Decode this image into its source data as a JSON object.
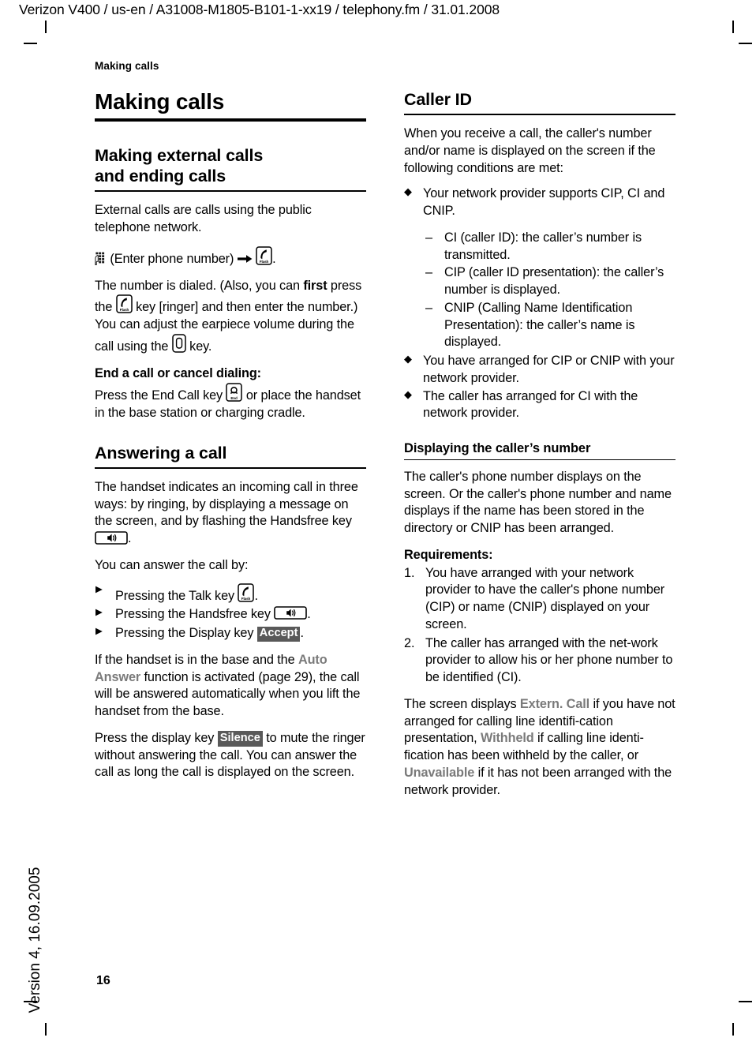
{
  "doc": {
    "slug": "Verizon V400 / us-en / A31008-M1805-B101-1-xx19 / telephony.fm / 31.01.2008",
    "version_footer": "Version 4, 16.09.2005",
    "page_number": "16",
    "running_head": "Making calls"
  },
  "left": {
    "h1": "Making calls",
    "making_external": {
      "heading_line1": "Making external calls",
      "heading_line2": "and ending calls",
      "p1": "External calls are calls using the public telephone network.",
      "dial_line_a": "(Enter phone number)",
      "dial_line_b": ".",
      "p2_a": "The number is dialed. (Also, you can ",
      "p2_first": "first",
      "p2_b": " press the ",
      "p2_c": " key [ringer] and then enter the number.) You can adjust the earpiece volume during the call using the ",
      "p2_d": " key.",
      "end_call_heading": "End a call or cancel dialing:",
      "p3_a": "Press the End Call key ",
      "p3_b": " or place the handset in the base station or charging cradle."
    },
    "answering": {
      "heading": "Answering a call",
      "p1_a": "The handset indicates an incoming call in three ways: by ringing, by displaying a message on the screen, and by flashing the Handsfree key ",
      "p1_b": ".",
      "p2": "You can answer the call by:",
      "bullets": [
        {
          "a": "Pressing the Talk key ",
          "b": "."
        },
        {
          "a": "Pressing the Handsfree key ",
          "b": "."
        },
        {
          "a": "Pressing the Display key ",
          "key": "Accept",
          "b": "."
        }
      ],
      "p3_a": "If the handset is in the base and the ",
      "p3_term": "Auto Answer",
      "p3_b": " function is activated (page 29), the call will be answered automatically when you lift the handset from the base.",
      "p4_a": "Press the display key ",
      "p4_key": "Silence",
      "p4_b": " to mute the ringer without answering the call. You can answer the call as long the call is displayed on the screen."
    }
  },
  "right": {
    "caller_id": {
      "heading": "Caller ID",
      "p1": "When you receive a call, the caller's number and/or name is displayed on the screen if the following conditions are met:",
      "bullet1": "Your network provider supports CIP, CI and CNIP.",
      "sub1": "CI (caller ID): the caller’s number is transmitted.",
      "sub2": "CIP (caller ID presentation): the caller’s number is displayed.",
      "sub3": "CNIP (Calling Name Identification Presentation): the caller’s name is displayed.",
      "bullet2": "You have arranged for CIP or CNIP with your network provider.",
      "bullet3": "The caller has arranged for CI with the network provider."
    },
    "displaying": {
      "heading": "Displaying the caller’s number",
      "p1": "The caller's phone number displays on the screen. Or the caller's phone number and name displays if the name has been stored in the directory or CNIP has been arranged.",
      "requirements_heading": "Requirements:",
      "req1": "You have arranged with your network provider to have the caller's phone number (CIP) or name (CNIP) displayed on your screen.",
      "req2": "The caller has arranged with the net-work provider to allow his or her phone number to be identified (CI).",
      "p2_a": "The screen displays ",
      "p2_term1": "Extern. Call",
      "p2_b": " if you have not arranged for calling line identifi-cation presentation, ",
      "p2_term2": "Withheld",
      "p2_c": " if calling line identi-fication has been withheld by the caller, or ",
      "p2_term3": "Unavailable",
      "p2_d": "  if it has not been arranged with the network provider."
    }
  },
  "icons": {
    "keypad": "keypad-icon",
    "arrow_right": "arrow-right-icon",
    "talk_key": "talk-key-icon",
    "talk_key_label": "Flash",
    "end_key": "end-key-icon",
    "end_key_label": "End",
    "volume_key": "volume-key-icon",
    "handsfree_key": "handsfree-key-icon"
  },
  "colors": {
    "text": "#000000",
    "softkey_term": "#7a7a7a",
    "display_key_bg": "#595959",
    "rule": "#000000"
  }
}
